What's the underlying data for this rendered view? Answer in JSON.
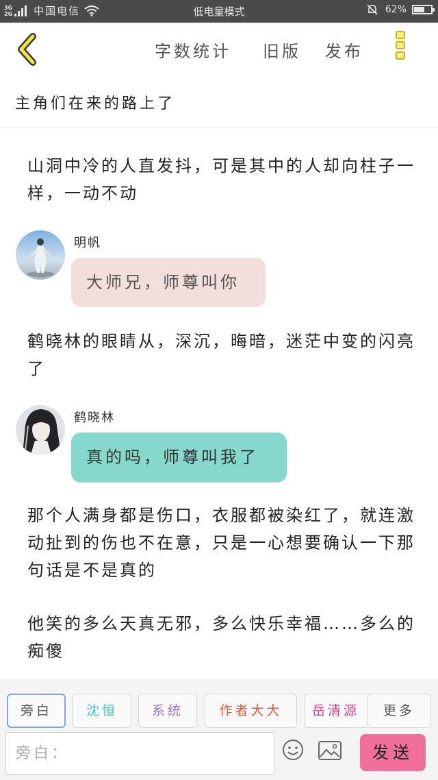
{
  "status_bar": {
    "network_top": "3G",
    "network_bottom": "2G",
    "carrier": "中国电信",
    "mode": "低电量模式",
    "battery": "62%",
    "battery_level": 0.62
  },
  "toolbar": {
    "word_count": "字数统计",
    "old_version": "旧版",
    "publish": "发布"
  },
  "story_title": "主角们在来的路上了",
  "content": {
    "para1": "山洞中冷的人直发抖，可是其中的人却向柱子一样，一动不动",
    "message1": {
      "speaker": "明帆",
      "text": "大师兄，师尊叫你",
      "bubble_color": "#f2dedb"
    },
    "para2": "鹤晓林的眼睛从，深沉，晦暗，迷茫中变的闪亮了",
    "message2": {
      "speaker": "鹤晓林",
      "text": "真的吗，师尊叫我了",
      "bubble_color": "#86d8cc"
    },
    "para3": "那个人满身都是伤口，衣服都被染红了，就连激动扯到的伤也不在意，只是一心想要确认一下那句话是不是真的",
    "para4": "他笑的多么天真无邪，多么快乐幸福……多么的痴傻"
  },
  "roles": [
    {
      "label": "旁白",
      "color": "#555555"
    },
    {
      "label": "沈恒",
      "color": "#3fbfc0"
    },
    {
      "label": "系统",
      "color": "#9b6fd0"
    },
    {
      "label": "作者大大",
      "color": "#e2573f"
    },
    {
      "label": "岳清源",
      "color": "#d0408e"
    },
    {
      "label": "更多",
      "color": "#555555"
    }
  ],
  "input": {
    "placeholder": "旁白："
  },
  "send_label": "发送",
  "icons": [
    "back-arrow-icon",
    "more-menu-icon",
    "emoji-icon",
    "image-icon",
    "wifi-icon",
    "mute-bell-icon",
    "battery-icon"
  ]
}
